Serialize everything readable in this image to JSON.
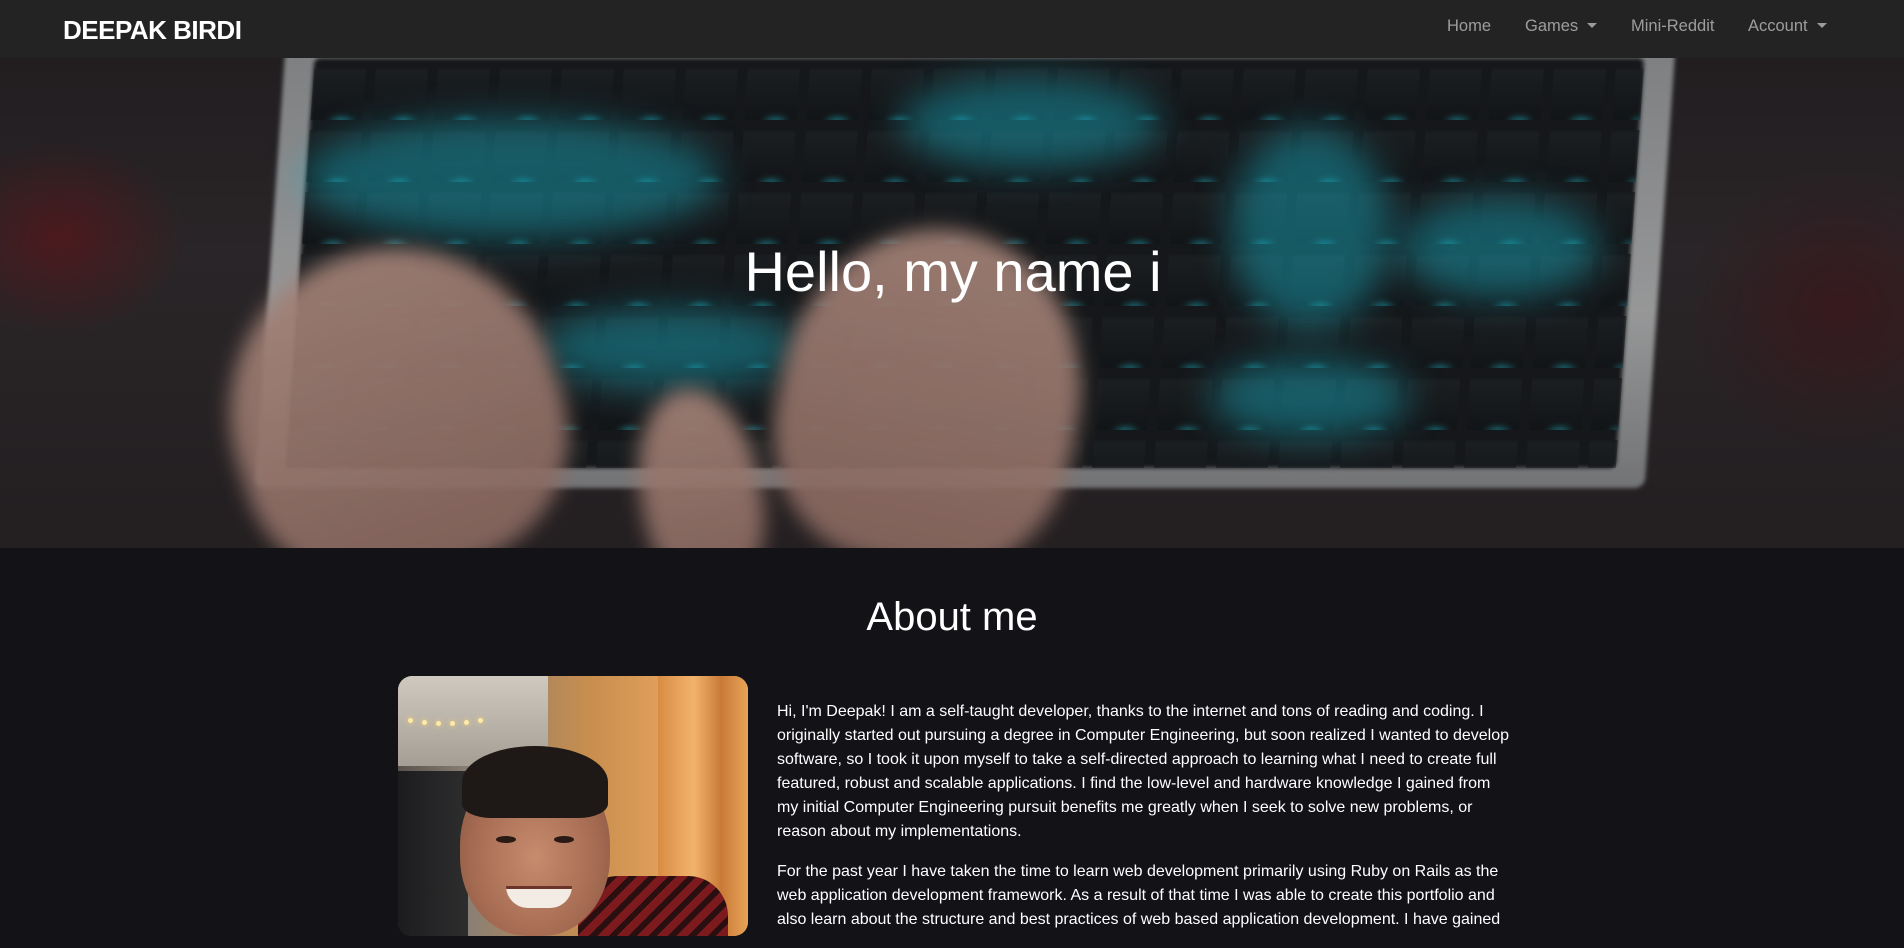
{
  "navbar": {
    "brand": "DEEPAK BIRDI",
    "items": [
      {
        "label": "Home",
        "dropdown": false
      },
      {
        "label": "Games",
        "dropdown": true
      },
      {
        "label": "Mini-Reddit",
        "dropdown": false
      },
      {
        "label": "Account",
        "dropdown": true
      }
    ]
  },
  "hero": {
    "title": "Hello, my name i"
  },
  "about": {
    "heading": "About me",
    "paragraphs": [
      "Hi, I'm Deepak! I am a self-taught developer, thanks to the internet and tons of reading and coding. I originally started out pursuing a degree in Computer Engineering, but soon realized I wanted to develop software, so I took it upon myself to take a self-directed approach to learning what I need to create full featured, robust and scalable applications. I find the low-level and hardware knowledge I gained from my initial Computer Engineering pursuit benefits me greatly when I seek to solve new problems, or reason about my implementations.",
      "For the past year I have taken the time to learn web development primarily using Ruby on Rails as the web application development framework. As a result of that time I was able to create this portfolio and also learn about the structure and best practices of web based application development. I have gained"
    ]
  },
  "colors": {
    "navbar_bg": "#232323",
    "page_bg": "#121217",
    "nav_link": "#8c8c8c",
    "text": "#ffffff"
  }
}
